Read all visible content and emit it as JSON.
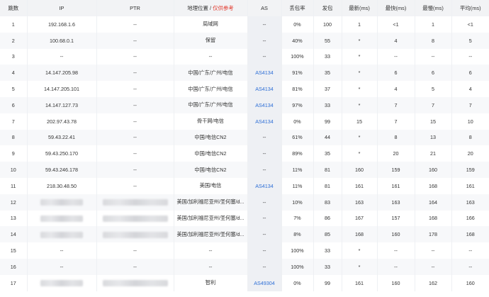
{
  "headers": {
    "hop": "跳数",
    "ip": "IP",
    "ptr": "PTR",
    "loc": "地理位置",
    "loc_sep": " / ",
    "loc_note": "仅供参考",
    "as": "AS",
    "loss": "丢包率",
    "sent": "发包",
    "last": "最新(ms)",
    "best": "最快(ms)",
    "worst": "最慢(ms)",
    "avg": "平均(ms)"
  },
  "colors": {
    "as_link": "#2f6fd6",
    "warn": "#e23b2e",
    "header_bg": "#f2f3f5"
  },
  "rows": [
    {
      "hop": "1",
      "ip": "192.168.1.6",
      "ptr": "--",
      "loc": "局域网",
      "as": "--",
      "loss": "0%",
      "sent": "100",
      "last": "1",
      "best": "<1",
      "worst": "1",
      "avg": "<1"
    },
    {
      "hop": "2",
      "ip": "100.68.0.1",
      "ptr": "--",
      "loc": "保留",
      "as": "--",
      "loss": "40%",
      "sent": "55",
      "last": "*",
      "best": "4",
      "worst": "8",
      "avg": "5"
    },
    {
      "hop": "3",
      "ip": "--",
      "ptr": "--",
      "loc": "--",
      "as": "--",
      "loss": "100%",
      "sent": "33",
      "last": "*",
      "best": "--",
      "worst": "--",
      "avg": "--"
    },
    {
      "hop": "4",
      "ip": "14.147.205.98",
      "ptr": "--",
      "loc": "中国/广东/广州/电信",
      "as": "AS4134",
      "loss": "91%",
      "sent": "35",
      "last": "*",
      "best": "6",
      "worst": "6",
      "avg": "6"
    },
    {
      "hop": "5",
      "ip": "14.147.205.101",
      "ptr": "--",
      "loc": "中国/广东/广州/电信",
      "as": "AS4134",
      "loss": "81%",
      "sent": "37",
      "last": "*",
      "best": "4",
      "worst": "5",
      "avg": "4"
    },
    {
      "hop": "6",
      "ip": "14.147.127.73",
      "ptr": "--",
      "loc": "中国/广东/广州/电信",
      "as": "AS4134",
      "loss": "97%",
      "sent": "33",
      "last": "*",
      "best": "7",
      "worst": "7",
      "avg": "7"
    },
    {
      "hop": "7",
      "ip": "202.97.43.78",
      "ptr": "--",
      "loc": "骨干网/电信",
      "as": "AS4134",
      "loss": "0%",
      "sent": "99",
      "last": "15",
      "best": "7",
      "worst": "15",
      "avg": "10"
    },
    {
      "hop": "8",
      "ip": "59.43.22.41",
      "ptr": "--",
      "loc": "中国/电信CN2",
      "as": "--",
      "loss": "61%",
      "sent": "44",
      "last": "*",
      "best": "8",
      "worst": "13",
      "avg": "8"
    },
    {
      "hop": "9",
      "ip": "59.43.250.170",
      "ptr": "--",
      "loc": "中国/电信CN2",
      "as": "--",
      "loss": "89%",
      "sent": "35",
      "last": "*",
      "best": "20",
      "worst": "21",
      "avg": "20"
    },
    {
      "hop": "10",
      "ip": "59.43.246.178",
      "ptr": "--",
      "loc": "中国/电信CN2",
      "as": "--",
      "loss": "11%",
      "sent": "81",
      "last": "160",
      "best": "159",
      "worst": "160",
      "avg": "159"
    },
    {
      "hop": "11",
      "ip": "218.30.48.50",
      "ptr": "--",
      "loc": "美国/电信",
      "as": "AS4134",
      "loss": "11%",
      "sent": "81",
      "last": "161",
      "best": "161",
      "worst": "168",
      "avg": "161"
    },
    {
      "hop": "12",
      "ip": "",
      "ptr": "",
      "loc": "美国/加利福尼亚州/圣何塞/d...",
      "as": "--",
      "loss": "10%",
      "sent": "83",
      "last": "163",
      "best": "163",
      "worst": "164",
      "avg": "163"
    },
    {
      "hop": "13",
      "ip": "",
      "ptr": "",
      "loc": "美国/加利福尼亚州/圣何塞/d...",
      "as": "--",
      "loss": "7%",
      "sent": "86",
      "last": "167",
      "best": "157",
      "worst": "168",
      "avg": "166"
    },
    {
      "hop": "14",
      "ip": "",
      "ptr": "",
      "loc": "美国/加利福尼亚州/圣何塞/d...",
      "as": "--",
      "loss": "8%",
      "sent": "85",
      "last": "168",
      "best": "160",
      "worst": "178",
      "avg": "168"
    },
    {
      "hop": "15",
      "ip": "--",
      "ptr": "--",
      "loc": "--",
      "as": "--",
      "loss": "100%",
      "sent": "33",
      "last": "*",
      "best": "--",
      "worst": "--",
      "avg": "--"
    },
    {
      "hop": "16",
      "ip": "--",
      "ptr": "--",
      "loc": "--",
      "as": "--",
      "loss": "100%",
      "sent": "33",
      "last": "*",
      "best": "--",
      "worst": "--",
      "avg": "--"
    },
    {
      "hop": "17",
      "ip": "",
      "ptr": "",
      "loc": "智利",
      "as": "AS49304",
      "loss": "0%",
      "sent": "99",
      "last": "161",
      "best": "160",
      "worst": "162",
      "avg": "160"
    }
  ]
}
